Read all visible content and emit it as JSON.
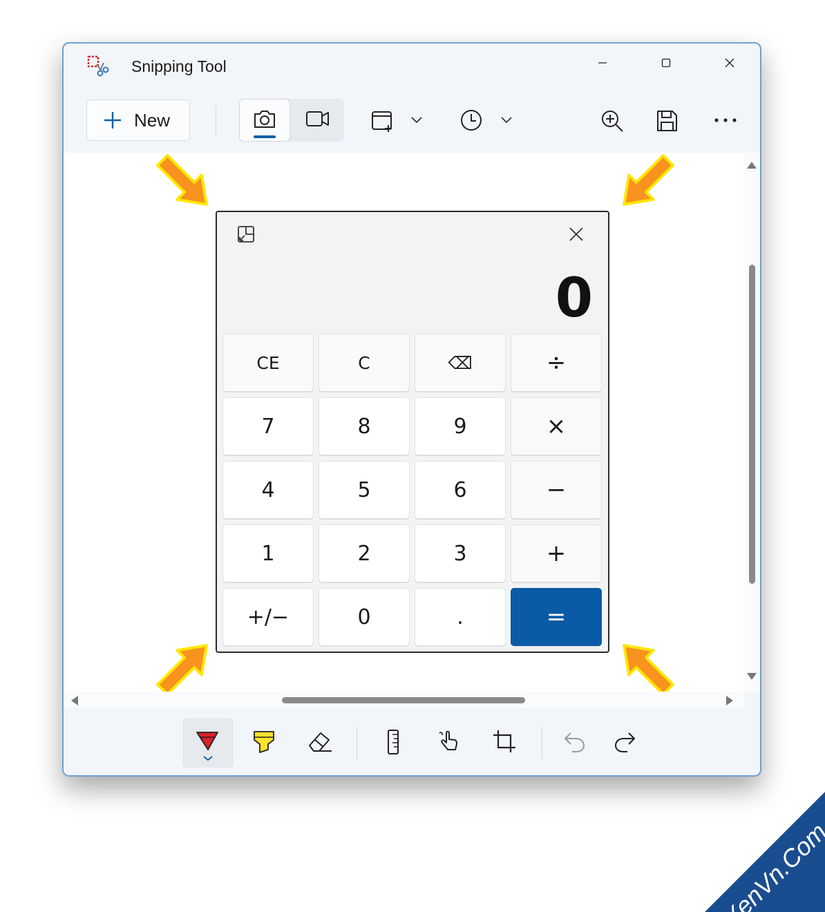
{
  "window": {
    "title": "Snipping Tool"
  },
  "toolbar": {
    "new_label": "New",
    "icons": [
      "plus-icon",
      "camera-icon",
      "video-icon",
      "snip-window-icon",
      "chevron-down-icon",
      "timer-icon",
      "chevron-down-icon",
      "zoom-in-icon",
      "save-icon",
      "more-icon"
    ]
  },
  "calculator": {
    "display": "0",
    "keys": [
      {
        "label": "CE",
        "kind": "fn"
      },
      {
        "label": "C",
        "kind": "fn"
      },
      {
        "label": "⌫",
        "kind": "fn"
      },
      {
        "label": "÷",
        "kind": "op"
      },
      {
        "label": "7",
        "kind": "num"
      },
      {
        "label": "8",
        "kind": "num"
      },
      {
        "label": "9",
        "kind": "num"
      },
      {
        "label": "×",
        "kind": "op"
      },
      {
        "label": "4",
        "kind": "num"
      },
      {
        "label": "5",
        "kind": "num"
      },
      {
        "label": "6",
        "kind": "num"
      },
      {
        "label": "−",
        "kind": "op"
      },
      {
        "label": "1",
        "kind": "num"
      },
      {
        "label": "2",
        "kind": "num"
      },
      {
        "label": "3",
        "kind": "num"
      },
      {
        "label": "+",
        "kind": "op"
      },
      {
        "label": "+/−",
        "kind": "num"
      },
      {
        "label": "0",
        "kind": "num"
      },
      {
        "label": ".",
        "kind": "num"
      },
      {
        "label": "=",
        "kind": "eq"
      }
    ]
  },
  "bottom_tools": [
    "ballpoint-pen-icon",
    "highlighter-icon",
    "eraser-icon",
    "ruler-icon",
    "touch-writing-icon",
    "crop-icon",
    "undo-icon",
    "redo-icon"
  ],
  "colors": {
    "accent": "#0b5aa6",
    "arrow_fill": "#f7931e",
    "arrow_outline": "#ffe600",
    "pen_red": "#d9232a",
    "highlighter": "#ffe22b"
  },
  "watermark": {
    "text": "XenVn.Com",
    "color": "#1a4d8f"
  }
}
